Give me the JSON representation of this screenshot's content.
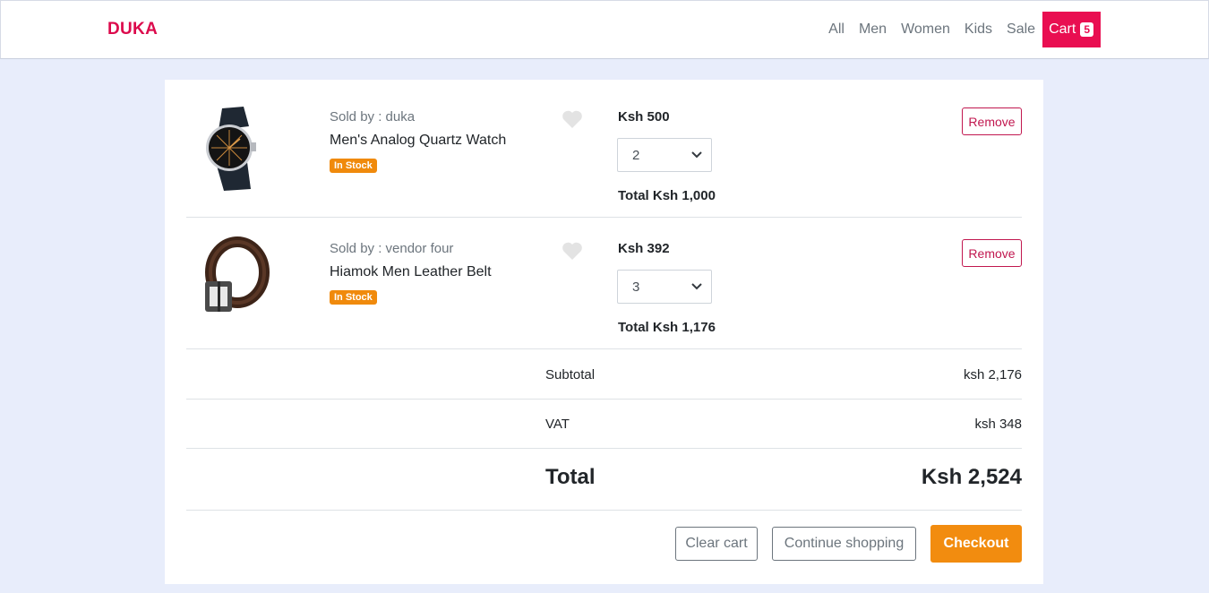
{
  "navbar": {
    "brand": "DUKA",
    "links": [
      "All",
      "Men",
      "Women",
      "Kids",
      "Sale"
    ],
    "cart_label": "Cart",
    "cart_count": "5"
  },
  "cart": {
    "items": [
      {
        "seller": "Sold by : duka",
        "name": "Men's Analog Quartz Watch",
        "stock": "In Stock",
        "price": "Ksh 500",
        "quantity": "2",
        "total": "Total Ksh 1,000",
        "remove_label": "Remove",
        "image_icon": "watch-image"
      },
      {
        "seller": "Sold by : vendor four",
        "name": "Hiamok Men Leather Belt",
        "stock": "In Stock",
        "price": "Ksh 392",
        "quantity": "3",
        "total": "Total Ksh 1,176",
        "remove_label": "Remove",
        "image_icon": "belt-image"
      }
    ],
    "summary": {
      "subtotal_label": "Subtotal",
      "subtotal_value": "ksh 2,176",
      "vat_label": "VAT",
      "vat_value": "ksh 348",
      "total_label": "Total",
      "total_value": "Ksh 2,524"
    },
    "actions": {
      "clear_label": "Clear cart",
      "continue_label": "Continue shopping",
      "checkout_label": "Checkout"
    }
  },
  "colors": {
    "brand": "#dc0a4c",
    "cart_bg": "#e90e51",
    "stock_badge": "#f08a0c",
    "checkout": "#f28c0f",
    "page_bg": "#e8edfb"
  }
}
